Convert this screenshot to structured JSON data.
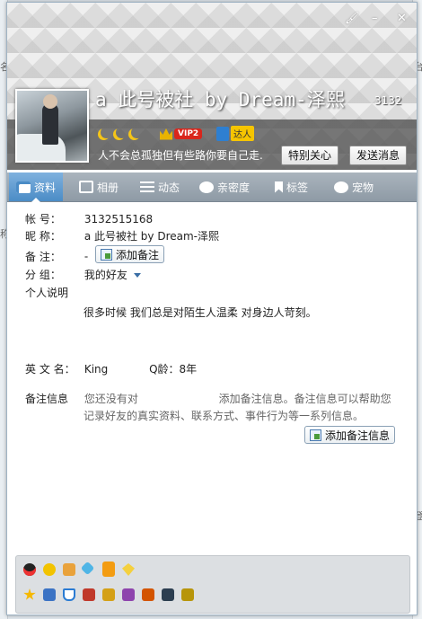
{
  "window_controls": {
    "skin": "🖌",
    "minimize": "–",
    "close": "✕"
  },
  "profile": {
    "nickname": "a 此号被社 by Dream-泽熙",
    "qq_number_partial": "3132",
    "signature": "人不会总孤独但有些路你要自己走.",
    "vip_label": "VIP2",
    "daren_label": "达人"
  },
  "header_buttons": {
    "special_care": "特别关心",
    "send_message": "发送消息"
  },
  "tabs": [
    {
      "label": "资料",
      "icon": "profile-card-icon"
    },
    {
      "label": "相册",
      "icon": "album-icon"
    },
    {
      "label": "动态",
      "icon": "feed-icon"
    },
    {
      "label": "亲密度",
      "icon": "heart-icon"
    },
    {
      "label": "标签",
      "icon": "bookmark-icon"
    },
    {
      "label": "宠物",
      "icon": "pet-icon"
    }
  ],
  "info": {
    "account_label": "帐    号：",
    "account_value": "3132515168",
    "nick_label": "昵    称：",
    "nick_value": "a 此号被社 by Dream-泽熙",
    "remark_label": "备    注：",
    "remark_value": "-",
    "add_remark_button": "添加备注",
    "group_label": "分    组：",
    "group_value": "我的好友",
    "bio_label": "个人说明",
    "bio_value": "很多时候 我们总是对陌生人温柔 对身边人苛刻。",
    "english_name_label": "英 文 名：",
    "english_name_value": "King",
    "qage_label": "Q龄：",
    "qage_value": "8年",
    "remark_info_label": "备注信息",
    "remark_info_text1": "您还没有对",
    "remark_info_text2": "添加备注信息。备注信息可以帮助您",
    "remark_info_text3": "记录好友的真实资料、联系方式、事件行为等一系列信息。",
    "add_remark_info_button": "添加备注信息"
  },
  "bg": {
    "left_glyph1": "名",
    "left_glyph2": "称",
    "right_glyph1": "台",
    "right_glyph2": "登"
  }
}
